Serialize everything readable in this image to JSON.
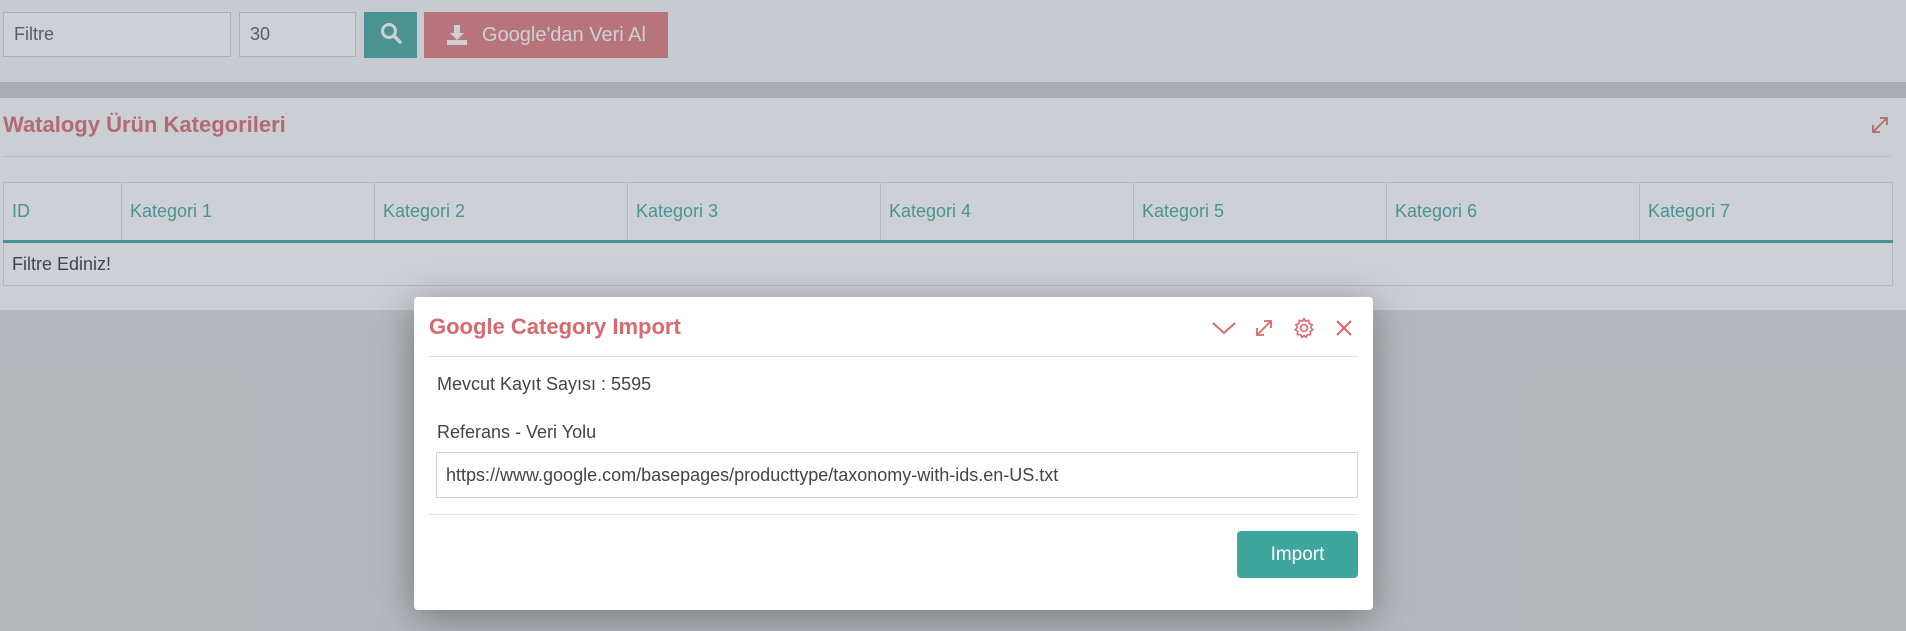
{
  "toolbar": {
    "filter_input": {
      "value": "Filtre"
    },
    "limit_input": {
      "value": "30"
    },
    "search_icon": "search-icon",
    "google_button": {
      "label": "Google'dan Veri Al",
      "icon": "download-icon"
    }
  },
  "panel": {
    "title": "Watalogy Ürün Kategorileri",
    "expand_icon": "expand-icon",
    "table": {
      "headers": [
        "ID",
        "Kategori 1",
        "Kategori 2",
        "Kategori 3",
        "Kategori 4",
        "Kategori 5",
        "Kategori 6",
        "Kategori 7"
      ],
      "empty_message": "Filtre Ediniz!"
    }
  },
  "modal": {
    "title": "Google Category Import",
    "icons": [
      "chevron-down-icon",
      "expand-icon",
      "gear-icon",
      "close-icon"
    ],
    "record_count": "Mevcut Kayıt Sayısı : 5595",
    "ref_label": "Referans - Veri Yolu",
    "url_value": "https://www.google.com/basepages/producttype/taxonomy-with-ids.en-US.txt",
    "import_label": "Import"
  },
  "colors": {
    "accent_teal": "#3fa69e",
    "accent_red": "#e0787d",
    "title_red": "#d86a6f"
  }
}
